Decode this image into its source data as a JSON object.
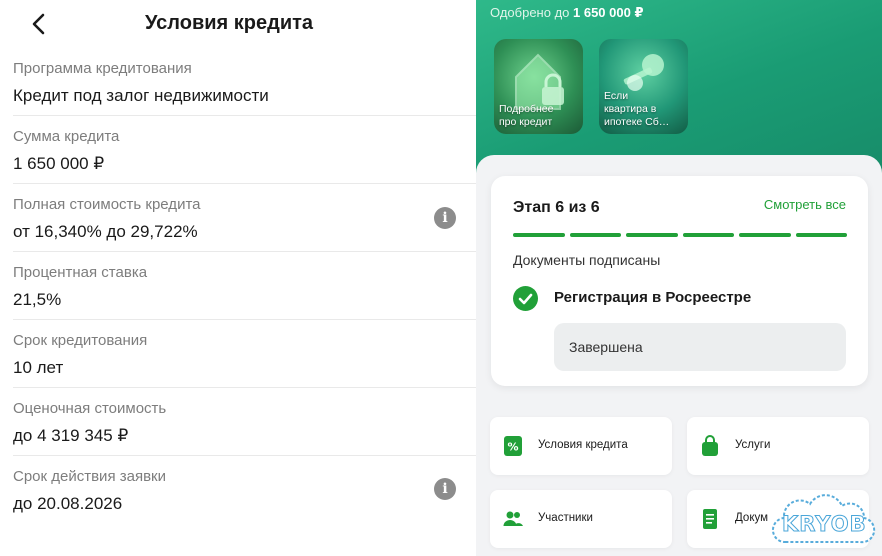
{
  "left": {
    "title": "Условия кредита",
    "rows": [
      {
        "label": "Программа кредитования",
        "value": "Кредит под залог недвижимости"
      },
      {
        "label": "Сумма кредита",
        "value": "1 650 000 ₽"
      },
      {
        "label": "Полная стоимость кредита",
        "value": "от 16,340% до 29,722%"
      },
      {
        "label": "Процентная ставка",
        "value": "21,5%"
      },
      {
        "label": "Срок кредитования",
        "value": "10 лет"
      },
      {
        "label": "Оценочная стоимость",
        "value": "до 4 319 345 ₽"
      },
      {
        "label": "Срок действия заявки",
        "value": "до 20.08.2026"
      }
    ]
  },
  "right": {
    "approved_prefix": "Одобрено до ",
    "approved_amount": "1 650 000 ₽",
    "stories": [
      {
        "line1": "Подробнее",
        "line2": "про кредит"
      },
      {
        "line1": "Если",
        "line2": "квартира в",
        "line3": "ипотеке Сб…"
      }
    ],
    "stage": "Этап 6 из 6",
    "see_all": "Смотреть все",
    "docs_signed": "Документы подписаны",
    "step_title": "Регистрация в Росреестре",
    "step_status": "Завершена",
    "tiles": [
      {
        "label": "Условия кредита",
        "icon": "percent-doc-icon"
      },
      {
        "label": "Услуги",
        "icon": "shopping-bag-icon"
      },
      {
        "label": "Участники",
        "icon": "people-icon"
      },
      {
        "label": "Докум",
        "icon": "document-icon"
      }
    ],
    "watermark": "KRYOB"
  },
  "colors": {
    "accent": "#21a038",
    "header_green": "#1a9c74",
    "info_gray": "#8c8c8c"
  }
}
